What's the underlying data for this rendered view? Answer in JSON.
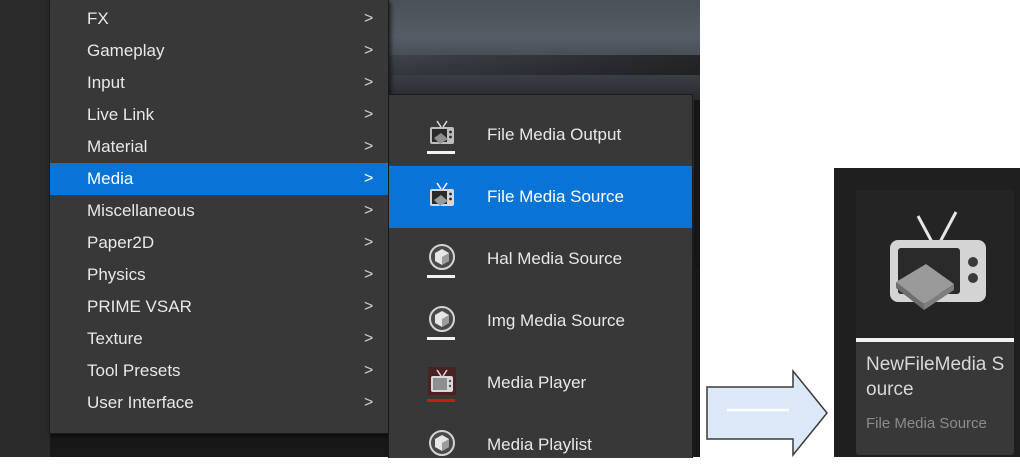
{
  "menu": {
    "items": [
      {
        "label": "FX",
        "active": false
      },
      {
        "label": "Gameplay",
        "active": false
      },
      {
        "label": "Input",
        "active": false
      },
      {
        "label": "Live Link",
        "active": false
      },
      {
        "label": "Material",
        "active": false
      },
      {
        "label": "Media",
        "active": true
      },
      {
        "label": "Miscellaneous",
        "active": false
      },
      {
        "label": "Paper2D",
        "active": false
      },
      {
        "label": "Physics",
        "active": false
      },
      {
        "label": "PRIME VSAR",
        "active": false
      },
      {
        "label": "Texture",
        "active": false
      },
      {
        "label": "Tool Presets",
        "active": false
      },
      {
        "label": "User Interface",
        "active": false
      }
    ],
    "chevron": ">"
  },
  "submenu": {
    "items": [
      {
        "label": "File Media Output",
        "icon": "tv-monitor-icon",
        "active": false
      },
      {
        "label": "File Media Source",
        "icon": "tv-monitor-icon",
        "active": true
      },
      {
        "label": "Hal Media Source",
        "icon": "sphere-icon",
        "active": false
      },
      {
        "label": "Img Media Source",
        "icon": "sphere-icon",
        "active": false
      },
      {
        "label": "Media Player",
        "icon": "tv-monitor-icon",
        "active": false
      },
      {
        "label": "Media Playlist",
        "icon": "sphere-icon",
        "active": false
      }
    ]
  },
  "asset_tile": {
    "name": "NewFileMedia Source",
    "type": "File Media Source",
    "icon": "tv-monitor-icon"
  },
  "colors": {
    "accent": "#0a74d6",
    "menu_bg": "#383838",
    "arrow_fill": "#dae8f8",
    "arrow_stroke": "#3a3a3a",
    "media_player_bar": "#d01818"
  }
}
